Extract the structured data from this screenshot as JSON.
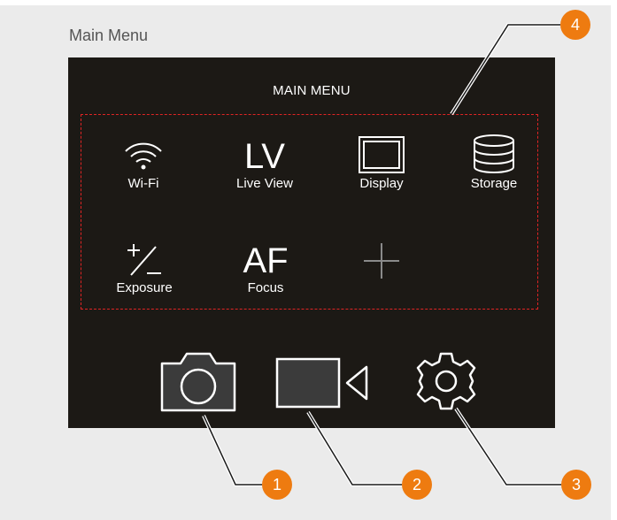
{
  "panel": {
    "title": "Main Menu"
  },
  "screen": {
    "title": "MAIN MENU",
    "menu_items": [
      {
        "label": "Wi-Fi",
        "icon": "wifi-icon"
      },
      {
        "label": "Live View",
        "glyph": "LV",
        "icon": "live-view-icon"
      },
      {
        "label": "Display",
        "icon": "display-icon"
      },
      {
        "label": "Storage",
        "icon": "storage-icon"
      },
      {
        "label": "Exposure",
        "icon": "exposure-icon"
      },
      {
        "label": "Focus",
        "glyph": "AF",
        "icon": "focus-icon"
      },
      {
        "label": "",
        "icon": "add-icon"
      }
    ],
    "bottom_bar": [
      {
        "icon": "camera-icon"
      },
      {
        "icon": "video-camera-icon"
      },
      {
        "icon": "settings-gear-icon"
      }
    ]
  },
  "callouts": [
    "1",
    "2",
    "3",
    "4"
  ],
  "colors": {
    "panel_background": "#ebebeb",
    "screen_background": "#1c1915",
    "callout_orange": "#ee7b10",
    "highlight_dashed_red": "#e02424",
    "icon_white": "#ffffff",
    "add_icon_gray": "#8a8a8a"
  }
}
